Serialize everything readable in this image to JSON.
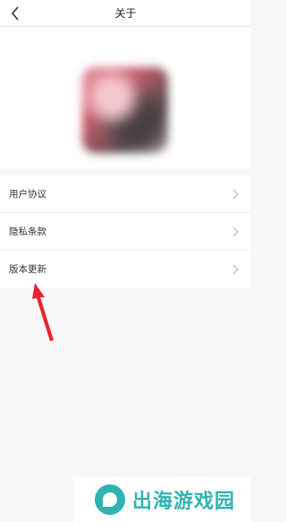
{
  "header": {
    "title": "关于",
    "back_icon": "chevron-left-icon"
  },
  "hero": {
    "logo": "app-logo"
  },
  "menu": {
    "items": [
      {
        "label": "用户协议",
        "icon": "chevron-right-icon"
      },
      {
        "label": "隐私条款",
        "icon": "chevron-right-icon"
      },
      {
        "label": "版本更新",
        "icon": "chevron-right-icon"
      }
    ]
  },
  "annotation": {
    "icon": "red-arrow-icon",
    "color": "#e8232e"
  },
  "watermark": {
    "text": "出海游戏园",
    "color": "#2fb3b0"
  }
}
